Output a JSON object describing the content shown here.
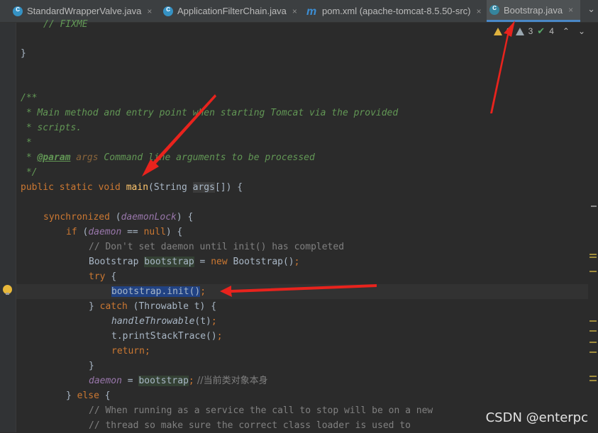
{
  "tabs": [
    {
      "label": "StandardWrapperValve.java",
      "icon": "java-class-icon",
      "active": false
    },
    {
      "label": "ApplicationFilterChain.java",
      "icon": "java-class-icon",
      "active": false
    },
    {
      "label": "pom.xml (apache-tomcat-8.5.50-src)",
      "icon": "maven-icon",
      "active": false
    },
    {
      "label": "Bootstrap.java",
      "icon": "java-class-icon",
      "active": true
    }
  ],
  "tab_close_glyph": "×",
  "tab_overflow_glyph": "⌄",
  "inspections": {
    "warnings": "9",
    "weak_warnings": "3",
    "ok": "4"
  },
  "code": {
    "l0": "// FIXME",
    "l1": "}",
    "l4": "/**",
    "l5": " * Main method and entry point when starting Tomcat via the provided",
    "l6": " * scripts.",
    "l7": " *",
    "l8_star": " * ",
    "l8_tag": "@param",
    "l8_name": "args",
    "l8_rest": " Command line arguments to be processed",
    "l9": " */",
    "l10": {
      "kw": "public static void ",
      "fn": "main",
      "p1": "(String ",
      "arg": "args",
      "p2": "[]) {"
    },
    "l12": {
      "kw": "synchronized ",
      "p1": "(",
      "fld": "daemonLock",
      "p2": ") {"
    },
    "l13": {
      "kw1": "if ",
      "p1": "(",
      "fld": "daemon",
      "p2": " == ",
      "kw2": "null",
      "p3": ") {"
    },
    "l14": "// Don't set daemon until init() has completed",
    "l15": {
      "p1": "Bootstrap ",
      "var": "bootstrap",
      "p2": " = ",
      "kw": "new ",
      "p3": "Bootstrap()",
      "semi": ";"
    },
    "l16": {
      "kw": "try ",
      "p1": "{"
    },
    "l17": {
      "sel": "bootstrap.init()",
      "semi": ";"
    },
    "l18": {
      "p1": "} ",
      "kw": "catch ",
      "p2": "(Throwable t) {"
    },
    "l19": {
      "it": "handleThrowable",
      "p1": "(t)",
      "semi": ";"
    },
    "l20": {
      "p1": "t.printStackTrace()",
      "semi": ";"
    },
    "l21": {
      "kw": "return",
      "semi": ";"
    },
    "l22": "}",
    "l23": {
      "fld": "daemon",
      "p1": " = ",
      "var": "bootstrap",
      "semi": ";",
      "cm": " //当前类对象本身"
    },
    "l24": {
      "p1": "} ",
      "kw": "else ",
      "p2": "{"
    },
    "l25": "// When running as a service the call to stop will be on a new",
    "l26": "// thread so make sure the correct class loader is used to"
  },
  "watermark": "CSDN @enterpc",
  "colors": {
    "arrow": "#e8231d",
    "keyword": "#cc7832",
    "doc": "#629755",
    "function": "#ffc66d",
    "field": "#9876aa",
    "selection": "#214283"
  }
}
